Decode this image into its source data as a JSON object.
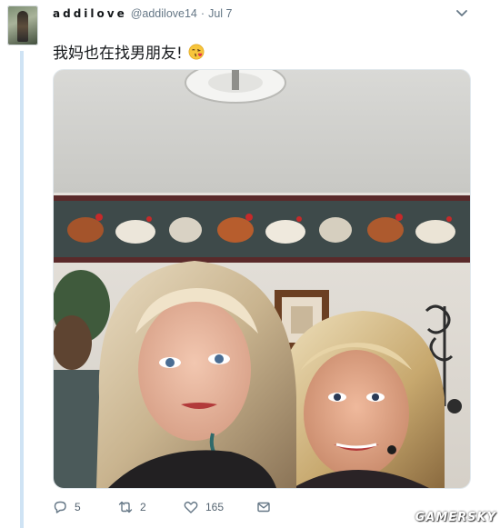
{
  "tweet": {
    "display_name": "addilove",
    "handle": "@addilove14",
    "separator": "·",
    "date": "Jul 7",
    "text": "我妈也在找男朋友!",
    "emoji_icon": "face-blowing-kiss-icon",
    "more_icon": "chevron-down-icon"
  },
  "actions": {
    "reply": {
      "icon": "reply-icon",
      "count": "5"
    },
    "retweet": {
      "icon": "retweet-icon",
      "count": "2"
    },
    "like": {
      "icon": "heart-icon",
      "count": "165"
    },
    "dm": {
      "icon": "envelope-icon"
    }
  },
  "watermark": "GAMERSKY",
  "colors": {
    "thread_line": "#cfe3f4",
    "muted_text": "#657786",
    "text": "#14171a",
    "border": "#e1e8ed"
  }
}
